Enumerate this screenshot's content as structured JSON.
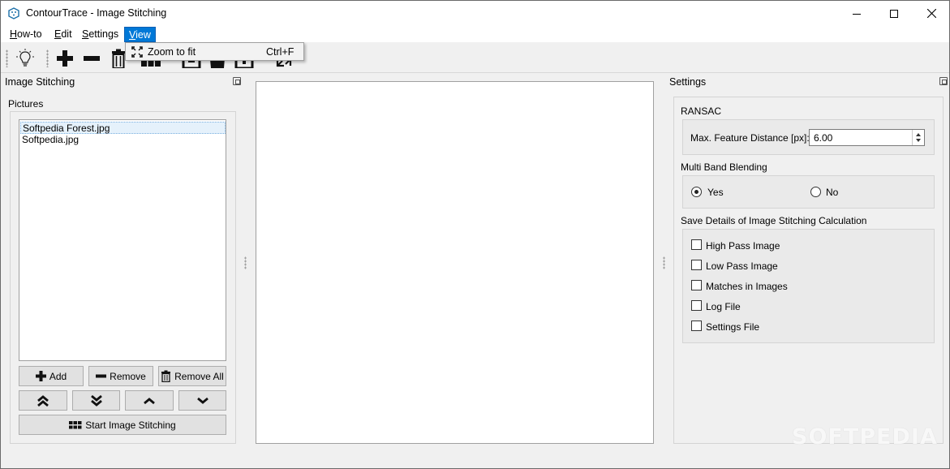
{
  "window": {
    "title": "ContourTrace - Image Stitching"
  },
  "menu": {
    "items": [
      {
        "label": "How-to",
        "underline": "H",
        "rest": "ow-to"
      },
      {
        "label": "Edit",
        "underline": "E",
        "rest": "dit"
      },
      {
        "label": "Settings",
        "underline": "S",
        "rest": "ettings"
      },
      {
        "label": "View",
        "underline": "V",
        "rest": "iew"
      }
    ],
    "view_dropdown": {
      "zoom_label": "Zoom to fit",
      "zoom_shortcut": "Ctrl+F"
    }
  },
  "toolbar": {
    "icons": [
      "lightbulb-icon",
      "plus-icon",
      "minus-icon",
      "trash-icon",
      "stitch-icon",
      "save-icon",
      "export-icon",
      "fit-icon"
    ]
  },
  "left_panel": {
    "title": "Image Stitching",
    "pictures_label": "Pictures",
    "pictures": [
      "Softpedia Forest.jpg",
      "Softpedia.jpg"
    ],
    "buttons": {
      "add": "Add",
      "remove": "Remove",
      "remove_all": "Remove All",
      "start": "Start Image Stitching"
    }
  },
  "right_panel": {
    "title": "Settings",
    "ransac": {
      "label": "RANSAC",
      "field_label": "Max. Feature Distance [px]:",
      "value": "6.00"
    },
    "blending": {
      "label": "Multi Band Blending",
      "yes": "Yes",
      "no": "No",
      "selected": "Yes"
    },
    "save_details": {
      "label": "Save Details of Image Stitching Calculation",
      "options": [
        "High Pass Image",
        "Low Pass Image",
        "Matches in Images",
        "Log File",
        "Settings File"
      ]
    }
  },
  "watermark": "SOFTPEDIA"
}
